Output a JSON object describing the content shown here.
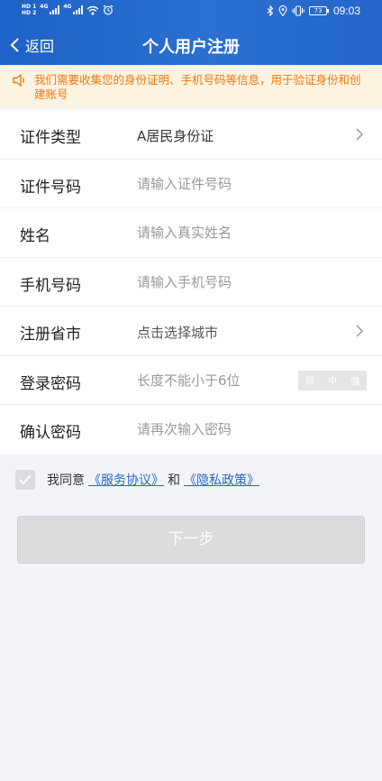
{
  "status_bar": {
    "sim1": "HD 1",
    "sim2": "HD 2",
    "net1": "4G",
    "net2": "4G",
    "battery": "73",
    "time": "09:03"
  },
  "nav": {
    "back_label": "返回",
    "title": "个人用户注册"
  },
  "notice": {
    "text": "我们需要收集您的身份证明、手机号码等信息，用于验证身份和创建账号",
    "icon": "speaker-icon",
    "color": "#ef7a12"
  },
  "form": {
    "rows": [
      {
        "label": "证件类型",
        "value": "A居民身份证"
      },
      {
        "label": "证件号码",
        "placeholder": "请输入证件号码"
      },
      {
        "label": "姓名",
        "placeholder": "请输入真实姓名"
      },
      {
        "label": "手机号码",
        "placeholder": "请输入手机号码"
      },
      {
        "label": "注册省市",
        "value": "点击选择城市"
      },
      {
        "label": "登录密码",
        "placeholder": "长度不能小于6位"
      },
      {
        "label": "确认密码",
        "placeholder": "请再次输入密码"
      }
    ],
    "strength": [
      "弱",
      "中",
      "强"
    ]
  },
  "agreement": {
    "prefix": "我同意",
    "service_link": "《服务协议》",
    "and": "和",
    "privacy_link": "《隐私政策》"
  },
  "next_button": "下一步",
  "colors": {
    "header": "#2468cc",
    "link": "#2a67c9",
    "button_disabled": "#dcdcdc"
  }
}
